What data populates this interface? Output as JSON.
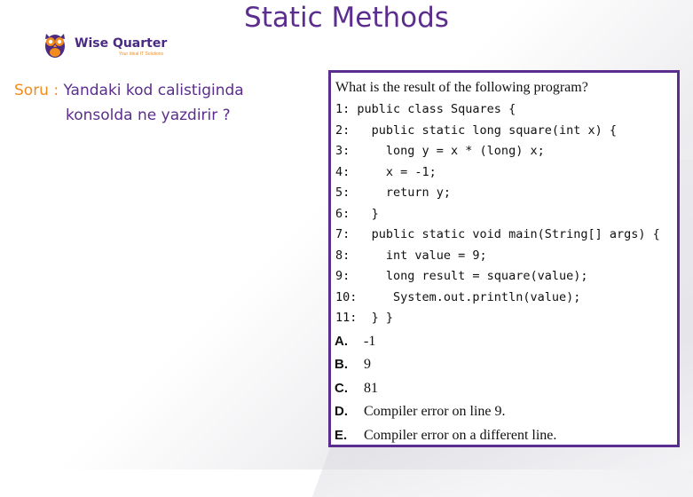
{
  "slide": {
    "title": "Static Methods",
    "brand_colors": {
      "purple": "#5b2d8e",
      "orange": "#f28c1e"
    }
  },
  "logo": {
    "name": "Wise Quarter",
    "tagline": "Your Ideal IT Solutions",
    "icon": "owl-icon"
  },
  "question": {
    "label": "Soru :",
    "line1": "Yandaki kod calistiginda",
    "line2": "konsolda ne yazdirir ?"
  },
  "problem": {
    "prompt": "What is the result of the following program?",
    "code": [
      "1: public class Squares {",
      "2:   public static long square(int x) {",
      "3:     long y = x * (long) x;",
      "4:     x = -1;",
      "5:     return y;",
      "6:   }",
      "7:   public static void main(String[] args) {",
      "8:     int value = 9;",
      "9:     long result = square(value);",
      "10:     System.out.println(value);",
      "11:  } }"
    ],
    "options": [
      {
        "letter": "A.",
        "text": "-1"
      },
      {
        "letter": "B.",
        "text": "9"
      },
      {
        "letter": "C.",
        "text": "81"
      },
      {
        "letter": "D.",
        "text": "Compiler error on line 9."
      },
      {
        "letter": "E.",
        "text": "Compiler error on a different line."
      }
    ]
  }
}
